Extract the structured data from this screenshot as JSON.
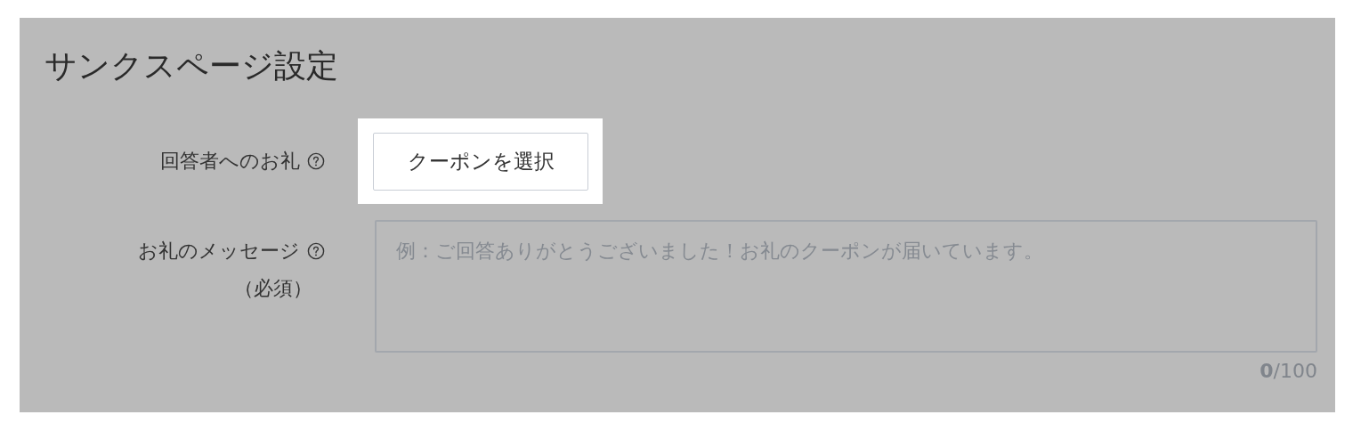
{
  "title": "サンクスページ設定",
  "fields": [
    {
      "kind": "button",
      "label": "回答者へのお礼",
      "help": true,
      "button": "クーポンを選択",
      "highlighted": true
    },
    {
      "kind": "textarea",
      "label": "お礼のメッセージ",
      "help": true,
      "note": "（必須）",
      "placeholder": "例：ご回答ありがとうございました！お礼のクーポンが届いています。",
      "counter": "**0**/100"
    }
  ]
}
